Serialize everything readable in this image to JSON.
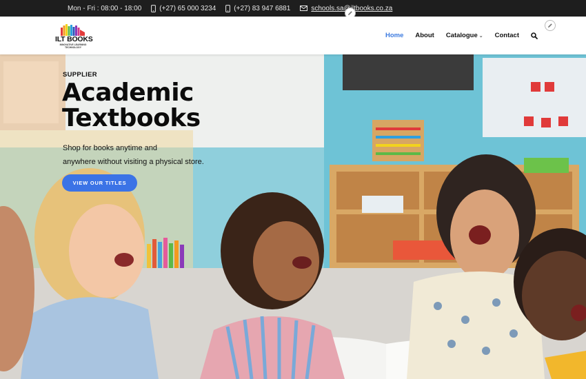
{
  "topbar": {
    "hours": "Mon - Fri : 08:00 - 18:00",
    "phone1": "(+27) 65 000 3234",
    "phone2": "(+27) 83 947 6881",
    "email": "schools.sa@iltbooks.co.za"
  },
  "logo": {
    "name": "ILT BOOKS",
    "tagline": "INNOVATIVE LEARNING TECHNOLOGY"
  },
  "nav": {
    "items": [
      {
        "label": "Home",
        "active": true
      },
      {
        "label": "About",
        "active": false
      },
      {
        "label": "Catalogue",
        "active": false,
        "dropdown": true
      },
      {
        "label": "Contact",
        "active": false
      }
    ],
    "search_icon": "search-icon"
  },
  "hero": {
    "overline": "SUPPLIER",
    "title_line1": "Academic",
    "title_line2": "Textbooks",
    "description_line1": "Shop for books anytime and",
    "description_line2": "anywhere without visiting a physical store.",
    "cta_label": "VIEW OUR TITLES"
  },
  "colors": {
    "accent": "#3d7be0",
    "button": "#3b73e6",
    "topbar_bg": "#1e1e1e"
  }
}
